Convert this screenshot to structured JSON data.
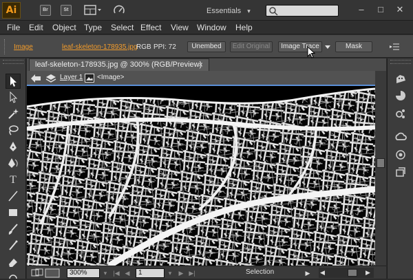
{
  "app": {
    "logo": "Ai",
    "workspace": "Essentials",
    "workspace_caret": "▾"
  },
  "title_icons": {
    "br": "Br",
    "st": "St"
  },
  "menu": [
    "File",
    "Edit",
    "Object",
    "Type",
    "Select",
    "Effect",
    "View",
    "Window",
    "Help"
  ],
  "control": {
    "object_type": "Image",
    "file_link": "leaf-skeleton-178935.jpg",
    "color_mode": "RGB",
    "ppi": "PPI: 72",
    "buttons": {
      "unembed": "Unembed",
      "edit_original": "Edit Original",
      "image_trace": "Image Trace",
      "mask": "Mask"
    }
  },
  "document": {
    "tab_title": "leaf-skeleton-178935.jpg @ 300% (RGB/Preview)",
    "close": "×",
    "layer": "Layer 1",
    "object": "<Image>"
  },
  "status": {
    "zoom": "300%",
    "artboard": "1",
    "tool": "Selection"
  }
}
